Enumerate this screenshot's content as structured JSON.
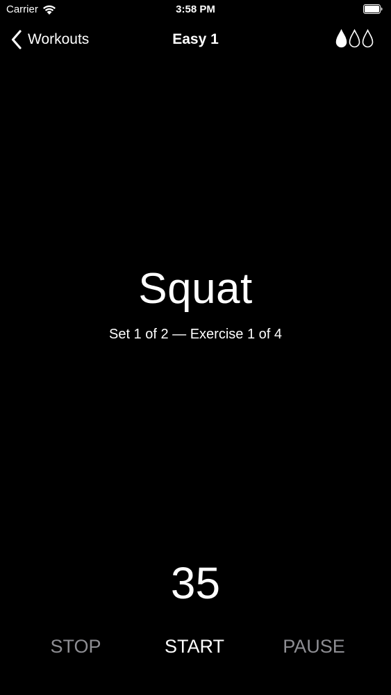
{
  "status_bar": {
    "carrier": "Carrier",
    "time": "3:58 PM"
  },
  "nav": {
    "back_label": "Workouts",
    "title": "Easy 1",
    "hydration_icons": [
      "drop-filled-icon",
      "drop-outline-icon",
      "drop-outline-icon"
    ]
  },
  "exercise": {
    "name": "Squat",
    "progress": "Set 1 of 2 — Exercise 1 of 4"
  },
  "timer": {
    "value": "35"
  },
  "controls": {
    "stop_label": "STOP",
    "start_label": "START",
    "pause_label": "PAUSE"
  },
  "colors": {
    "background": "#000000",
    "text_primary": "#ffffff",
    "control_active": "#ffffff",
    "control_disabled": "#8e8e93"
  }
}
